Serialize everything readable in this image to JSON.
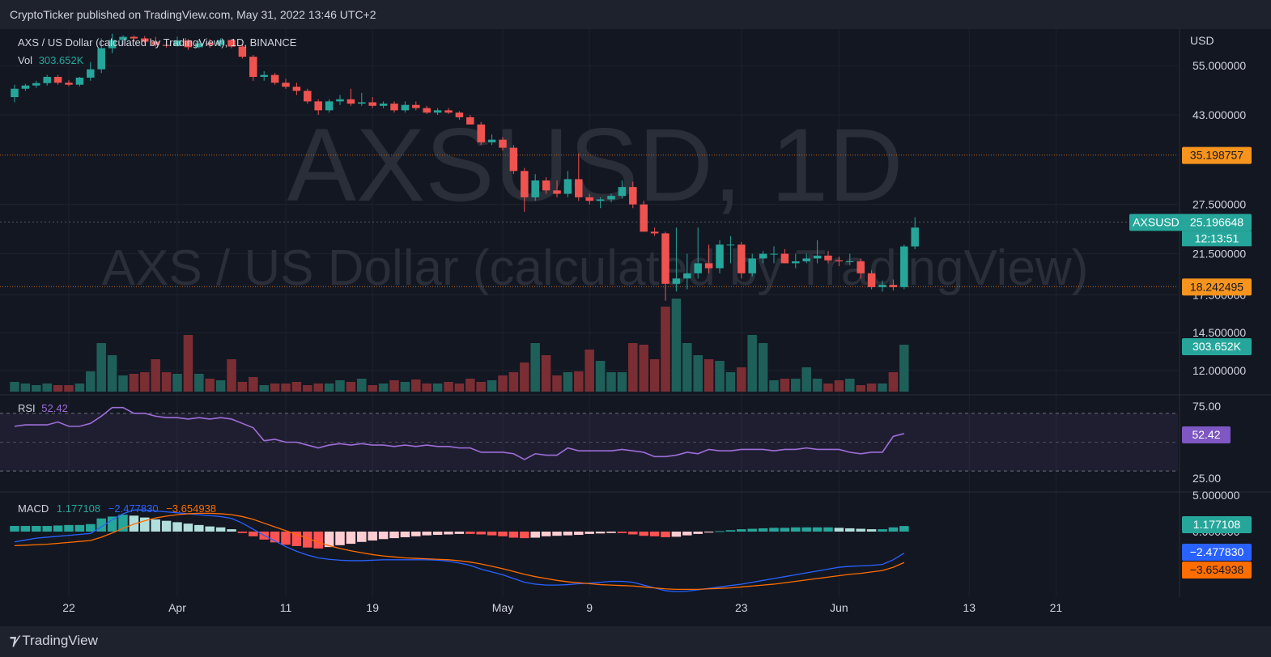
{
  "header": {
    "published": "CryptoTicker published on TradingView.com, May 31, 2022 13:46 UTC+2"
  },
  "footer": {
    "brand": "TradingView",
    "logo_icon": "tradingview-logo-icon"
  },
  "colors": {
    "up": "#26a69a",
    "down": "#ef5350",
    "rsi": "#9d6ed8",
    "macd": "#2962ff",
    "signal": "#ff6d00",
    "bg": "#131722",
    "watermark": "#2a2e39"
  },
  "watermark": {
    "line1": "AXSUSD, 1D",
    "line2": "AXS / US Dollar (calculated by TradingView)"
  },
  "legend": {
    "symbol": "AXS / US Dollar (calculated by TradingView), 1D, BINANCE",
    "vol_label": "Vol",
    "vol_value": "303.652K",
    "rsi_label": "RSI",
    "rsi_value": "52.42",
    "macd_label": "MACD",
    "macd_hist": "1.177108",
    "macd_line": "−2.477830",
    "signal_line": "−3.654938"
  },
  "price_axis": {
    "currency": "USD",
    "ticks": [
      "55.000000",
      "43.000000",
      "27.500000",
      "21.500000",
      "17.500000",
      "14.500000",
      "12.000000"
    ]
  },
  "badges": {
    "resistance": "35.198757",
    "support": "18.242495",
    "symbol": "AXSUSD",
    "last": "25.196648",
    "countdown": "12:13:51",
    "vol": "303.652K",
    "rsi": "52.42",
    "macd_hist": "1.177108",
    "macd_line": "−2.477830",
    "signal": "−3.654938"
  },
  "rsi_axis": {
    "ticks": [
      "75.00",
      "25.00"
    ]
  },
  "macd_axis": {
    "ticks": [
      "5.000000",
      "0.000000"
    ]
  },
  "time_axis": {
    "ticks": [
      "22",
      "Apr",
      "11",
      "19",
      "May",
      "9",
      "23",
      "Jun",
      "13",
      "21"
    ]
  },
  "chart_data": {
    "type": "candlestick",
    "title": "AXS / US Dollar (calculated by TradingView), 1D, BINANCE",
    "y_scale": "log",
    "x_start": "2022-03-17",
    "dates_note": "one candle per day, 2022-03-17 to 2022-05-31",
    "x_ticks": {
      "22": "2022-03-22",
      "Apr": "2022-04-01",
      "11": "2022-04-11",
      "19": "2022-04-19",
      "May": "2022-05-01",
      "9": "2022-05-09",
      "23": "2022-05-23",
      "Jun": "2022-06-01",
      "13": "2022-06-13",
      "21": "2022-06-21"
    },
    "ohlc": [
      [
        47.0,
        50.0,
        45.8,
        49.0
      ],
      [
        49.0,
        50.2,
        48.5,
        49.8
      ],
      [
        49.8,
        51.0,
        49.2,
        50.4
      ],
      [
        50.4,
        52.5,
        49.8,
        52.0
      ],
      [
        52.0,
        52.5,
        50.0,
        50.5
      ],
      [
        50.5,
        51.2,
        49.6,
        50.0
      ],
      [
        50.0,
        52.0,
        49.6,
        51.8
      ],
      [
        51.8,
        56.0,
        51.0,
        54.0
      ],
      [
        54.0,
        63.0,
        53.0,
        60.0
      ],
      [
        60.0,
        64.5,
        58.5,
        62.5
      ],
      [
        62.5,
        64.0,
        61.0,
        63.5
      ],
      [
        63.5,
        64.0,
        62.0,
        63.0
      ],
      [
        63.0,
        63.8,
        61.5,
        62.0
      ],
      [
        62.0,
        63.5,
        60.5,
        61.0
      ],
      [
        61.0,
        62.3,
        60.2,
        60.7
      ],
      [
        60.7,
        63.5,
        60.5,
        62.4
      ],
      [
        62.4,
        62.8,
        59.5,
        60.3
      ],
      [
        60.3,
        62.3,
        60.0,
        61.5
      ],
      [
        61.5,
        62.8,
        60.2,
        61.0
      ],
      [
        61.0,
        63.0,
        60.5,
        62.5
      ],
      [
        62.5,
        62.8,
        60.0,
        60.5
      ],
      [
        60.5,
        61.0,
        57.0,
        57.5
      ],
      [
        57.5,
        58.0,
        51.0,
        52.0
      ],
      [
        52.0,
        53.5,
        51.0,
        52.5
      ],
      [
        52.5,
        53.0,
        50.0,
        50.5
      ],
      [
        50.5,
        51.5,
        49.0,
        49.5
      ],
      [
        49.5,
        50.5,
        47.5,
        48.5
      ],
      [
        48.5,
        49.0,
        45.5,
        46.0
      ],
      [
        46.0,
        46.5,
        43.0,
        44.0
      ],
      [
        44.0,
        46.5,
        43.5,
        46.0
      ],
      [
        46.0,
        47.5,
        45.2,
        46.5
      ],
      [
        46.5,
        49.0,
        45.0,
        45.5
      ],
      [
        45.5,
        48.0,
        45.0,
        45.8
      ],
      [
        45.8,
        47.0,
        44.5,
        45.0
      ],
      [
        45.0,
        46.0,
        44.5,
        45.5
      ],
      [
        45.5,
        46.0,
        43.5,
        44.0
      ],
      [
        44.0,
        46.0,
        43.5,
        45.2
      ],
      [
        45.2,
        46.0,
        44.0,
        44.5
      ],
      [
        44.5,
        45.0,
        43.2,
        43.5
      ],
      [
        43.5,
        44.5,
        43.0,
        44.0
      ],
      [
        44.0,
        44.5,
        43.2,
        43.5
      ],
      [
        43.5,
        43.8,
        42.0,
        42.5
      ],
      [
        42.5,
        43.0,
        41.0,
        41.0
      ],
      [
        41.0,
        41.5,
        37.0,
        37.5
      ],
      [
        37.5,
        39.0,
        37.0,
        38.0
      ],
      [
        38.0,
        38.5,
        36.0,
        36.5
      ],
      [
        36.5,
        37.0,
        32.0,
        32.5
      ],
      [
        32.5,
        33.0,
        26.5,
        28.5
      ],
      [
        28.5,
        32.0,
        28.0,
        31.0
      ],
      [
        31.0,
        31.5,
        29.0,
        29.5
      ],
      [
        29.5,
        31.0,
        28.5,
        29.0
      ],
      [
        29.0,
        32.5,
        28.5,
        31.2
      ],
      [
        31.2,
        35.5,
        28.0,
        28.5
      ],
      [
        28.5,
        29.0,
        27.5,
        28.0
      ],
      [
        28.0,
        28.5,
        27.0,
        28.2
      ],
      [
        28.2,
        29.0,
        27.8,
        28.7
      ],
      [
        28.7,
        31.0,
        28.3,
        30.0
      ],
      [
        30.0,
        30.8,
        27.0,
        27.5
      ],
      [
        27.5,
        28.0,
        24.0,
        24.0
      ],
      [
        24.0,
        24.5,
        23.5,
        23.8
      ],
      [
        23.8,
        24.0,
        17.0,
        18.5
      ],
      [
        18.5,
        24.5,
        17.8,
        19.0
      ],
      [
        19.0,
        21.5,
        18.0,
        19.5
      ],
      [
        19.5,
        24.5,
        19.0,
        20.5
      ],
      [
        20.5,
        22.5,
        19.5,
        20.0
      ],
      [
        20.0,
        23.0,
        19.5,
        22.5
      ],
      [
        22.5,
        23.5,
        20.5,
        22.5
      ],
      [
        22.5,
        22.8,
        19.0,
        19.5
      ],
      [
        19.5,
        21.5,
        19.2,
        21.0
      ],
      [
        21.0,
        21.8,
        20.5,
        21.5
      ],
      [
        21.5,
        22.3,
        20.5,
        21.5
      ],
      [
        21.5,
        22.0,
        20.5,
        20.5
      ],
      [
        20.5,
        21.5,
        20.0,
        20.7
      ],
      [
        20.7,
        21.5,
        20.5,
        21.0
      ],
      [
        21.0,
        23.0,
        20.5,
        21.3
      ],
      [
        21.3,
        21.8,
        20.5,
        20.8
      ],
      [
        20.8,
        21.2,
        20.2,
        20.7
      ],
      [
        20.7,
        21.5,
        20.3,
        20.7
      ],
      [
        20.7,
        21.0,
        19.0,
        19.5
      ],
      [
        19.5,
        19.8,
        18.0,
        18.2
      ],
      [
        18.2,
        18.8,
        17.8,
        18.4
      ],
      [
        18.4,
        18.9,
        17.9,
        18.2
      ],
      [
        18.2,
        22.5,
        18.0,
        22.3
      ],
      [
        22.3,
        25.8,
        22.0,
        24.5
      ]
    ],
    "volume": [
      12,
      10,
      8,
      10,
      8,
      8,
      10,
      25,
      60,
      45,
      20,
      22,
      24,
      40,
      24,
      22,
      70,
      22,
      16,
      14,
      40,
      12,
      18,
      8,
      10,
      10,
      12,
      8,
      10,
      10,
      14,
      12,
      16,
      8,
      10,
      14,
      12,
      15,
      10,
      10,
      12,
      10,
      16,
      12,
      14,
      20,
      24,
      36,
      60,
      45,
      20,
      24,
      25,
      52,
      38,
      24,
      24,
      60,
      58,
      40,
      105,
      115,
      60,
      45,
      40,
      38,
      24,
      30,
      70,
      60,
      14,
      16,
      16,
      30,
      16,
      10,
      14,
      16,
      8,
      10,
      10,
      24,
      58
    ],
    "rsi": [
      61,
      62,
      62,
      62,
      64,
      61,
      61,
      63,
      68,
      74,
      74,
      70,
      70,
      68,
      67,
      67,
      66,
      67,
      66,
      67,
      66,
      63,
      60,
      51,
      52,
      50,
      50,
      48,
      46,
      48,
      49,
      48,
      49,
      48,
      48,
      47,
      48,
      47,
      48,
      47,
      47,
      46,
      46,
      43,
      43,
      43,
      42,
      38,
      42,
      41,
      41,
      46,
      44,
      44,
      44,
      44,
      45,
      44,
      43,
      40,
      40,
      41,
      43,
      42,
      45,
      44,
      44,
      45,
      45,
      45,
      44,
      45,
      45,
      46,
      45,
      45,
      45,
      43,
      42,
      43,
      43,
      54,
      56
    ],
    "macd_hist": [
      1.2,
      1.2,
      1.2,
      1.2,
      1.3,
      1.4,
      1.4,
      1.6,
      2.8,
      3.2,
      3.6,
      3.4,
      3.0,
      2.6,
      2.3,
      2.0,
      1.7,
      1.4,
      1.1,
      0.9,
      0.5,
      -0.3,
      -1.0,
      -1.7,
      -2.3,
      -2.8,
      -3.1,
      -3.4,
      -3.6,
      -3.3,
      -2.9,
      -2.6,
      -2.2,
      -1.9,
      -1.6,
      -1.4,
      -1.2,
      -1.0,
      -0.8,
      -0.7,
      -0.6,
      -0.5,
      -0.5,
      -0.6,
      -0.8,
      -1.0,
      -1.3,
      -1.4,
      -1.3,
      -1.0,
      -0.9,
      -0.8,
      -0.7,
      -0.5,
      -0.4,
      -0.3,
      -0.3,
      -0.6,
      -0.9,
      -1.0,
      -1.2,
      -1.1,
      -0.8,
      -0.5,
      -0.2,
      0.1,
      0.3,
      0.5,
      0.6,
      0.7,
      0.8,
      0.8,
      0.9,
      0.9,
      0.9,
      0.9,
      0.8,
      0.7,
      0.6,
      0.5,
      0.5,
      0.9,
      1.18
    ],
    "macd_line": [
      -2.2,
      -1.8,
      -1.4,
      -1.2,
      -1.0,
      -0.8,
      -0.6,
      -0.4,
      1.0,
      2.5,
      3.8,
      4.6,
      4.6,
      4.4,
      4.2,
      4.0,
      3.8,
      3.6,
      3.4,
      3.2,
      2.8,
      1.8,
      0.5,
      -0.8,
      -2.0,
      -3.2,
      -4.2,
      -5.0,
      -5.6,
      -5.9,
      -6.1,
      -6.2,
      -6.2,
      -6.1,
      -6.0,
      -6.0,
      -6.0,
      -6.0,
      -6.0,
      -6.1,
      -6.3,
      -6.7,
      -7.2,
      -8.0,
      -8.6,
      -9.2,
      -10.0,
      -10.8,
      -11.2,
      -11.4,
      -11.4,
      -11.3,
      -11.1,
      -11.0,
      -10.8,
      -10.6,
      -10.6,
      -10.8,
      -11.4,
      -12.0,
      -12.6,
      -12.8,
      -12.7,
      -12.4,
      -12.1,
      -11.8,
      -11.5,
      -11.2,
      -10.8,
      -10.4,
      -10.0,
      -9.6,
      -9.2,
      -8.8,
      -8.4,
      -8.0,
      -7.6,
      -7.4,
      -7.3,
      -7.2,
      -7.0,
      -6.0,
      -4.6
    ],
    "signal_line": [
      -3.0,
      -2.9,
      -2.8,
      -2.7,
      -2.5,
      -2.3,
      -2.1,
      -1.9,
      -1.2,
      -0.3,
      0.7,
      1.6,
      2.3,
      2.9,
      3.3,
      3.6,
      3.8,
      3.9,
      3.9,
      3.8,
      3.6,
      3.2,
      2.6,
      1.8,
      1.0,
      0.2,
      -0.6,
      -1.4,
      -2.3,
      -3.0,
      -3.6,
      -4.1,
      -4.5,
      -4.9,
      -5.2,
      -5.4,
      -5.6,
      -5.7,
      -5.8,
      -5.9,
      -6.0,
      -6.2,
      -6.5,
      -6.9,
      -7.4,
      -7.9,
      -8.5,
      -9.1,
      -9.6,
      -10.0,
      -10.4,
      -10.7,
      -10.9,
      -11.1,
      -11.3,
      -11.4,
      -11.5,
      -11.6,
      -11.8,
      -12.0,
      -12.2,
      -12.3,
      -12.3,
      -12.3,
      -12.2,
      -12.1,
      -12.0,
      -11.8,
      -11.6,
      -11.4,
      -11.2,
      -10.9,
      -10.6,
      -10.3,
      -10.0,
      -9.7,
      -9.4,
      -9.1,
      -8.9,
      -8.6,
      -8.3,
      -7.6,
      -6.6
    ],
    "horizontal_lines": [
      35.198757,
      18.242495,
      25.196648
    ],
    "rsi_band": [
      30,
      70
    ],
    "price_range": [
      10.8,
      66
    ],
    "grid": true
  }
}
